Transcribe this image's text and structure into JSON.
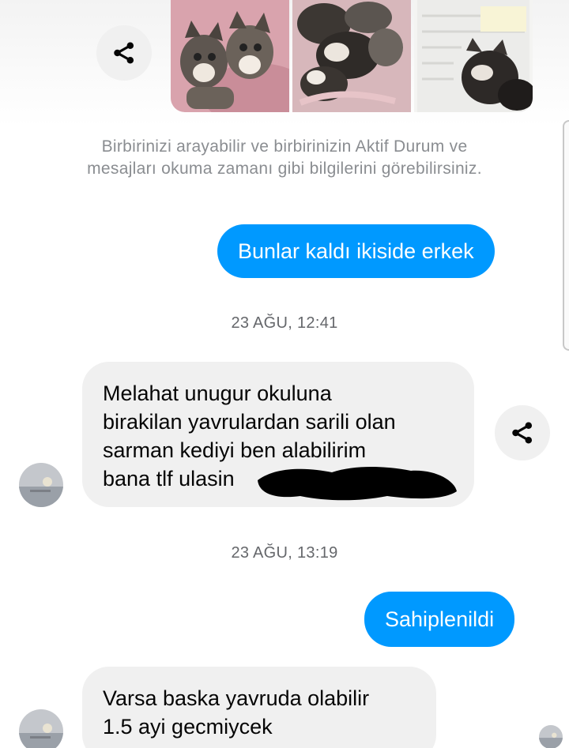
{
  "conversation": {
    "system_note": "Birbirinizi arayabilir ve birbirinizin Aktif Durum ve mesajları okuma zamanı gibi bilgilerini görebilirsiniz.",
    "messages": [
      {
        "direction": "out",
        "text": "Bunlar kaldı ikiside erkek"
      },
      {
        "type": "timestamp",
        "text": "23 AĞU, 12:41"
      },
      {
        "direction": "in",
        "lines": [
          "Melahat unugur okuluna",
          "birakilan yavrulardan sarili olan",
          "sarman kediyi ben alabilirim",
          "bana tlf ulasin"
        ]
      },
      {
        "type": "timestamp",
        "text": "23 AĞU, 13:19"
      },
      {
        "direction": "out",
        "text": "Sahiplenildi"
      },
      {
        "direction": "in",
        "lines": [
          "Varsa baska yavruda olabilir",
          "1.5 ayi gecmiycek"
        ]
      }
    ]
  },
  "icons": {
    "share": "share-icon",
    "avatar": "contact-avatar",
    "redaction": "redacted-phone-number"
  },
  "colors": {
    "outgoing_bubble": "#0099ff",
    "incoming_bubble": "#f0f0f0",
    "timestamp_text": "#65676b",
    "system_text": "#8a8d91"
  }
}
